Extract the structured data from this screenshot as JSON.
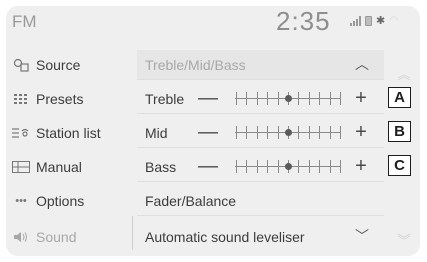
{
  "header": {
    "source_title": "FM",
    "clock": "2:35",
    "icons": [
      "signal-icon",
      "battery-icon",
      "bluetooth-icon",
      "wifi-icon"
    ]
  },
  "sidebar": {
    "items": [
      {
        "label": "Source",
        "icon": "source-icon",
        "enabled": true
      },
      {
        "label": "Presets",
        "icon": "presets-icon",
        "enabled": true
      },
      {
        "label": "Station list",
        "icon": "station-list-icon",
        "enabled": true
      },
      {
        "label": "Manual",
        "icon": "manual-icon",
        "enabled": true
      },
      {
        "label": "Options",
        "icon": "options-icon",
        "enabled": true
      },
      {
        "label": "Sound",
        "icon": "speaker-icon",
        "enabled": false
      }
    ]
  },
  "panel": {
    "header_label": "Treble/Mid/Bass",
    "rows": [
      {
        "label": "Treble",
        "minus": "—",
        "plus": "+",
        "level": 0,
        "callout": "A"
      },
      {
        "label": "Mid",
        "minus": "—",
        "plus": "+",
        "level": 0,
        "callout": "B"
      },
      {
        "label": "Bass",
        "minus": "—",
        "plus": "+",
        "level": 0,
        "callout": "C"
      }
    ],
    "fader_label": "Fader/Balance",
    "leveller_label": "Automatic sound leveliser"
  },
  "colors": {
    "background": "#efefef",
    "text": "#3c3c3c",
    "muted": "#a8a8a8"
  }
}
